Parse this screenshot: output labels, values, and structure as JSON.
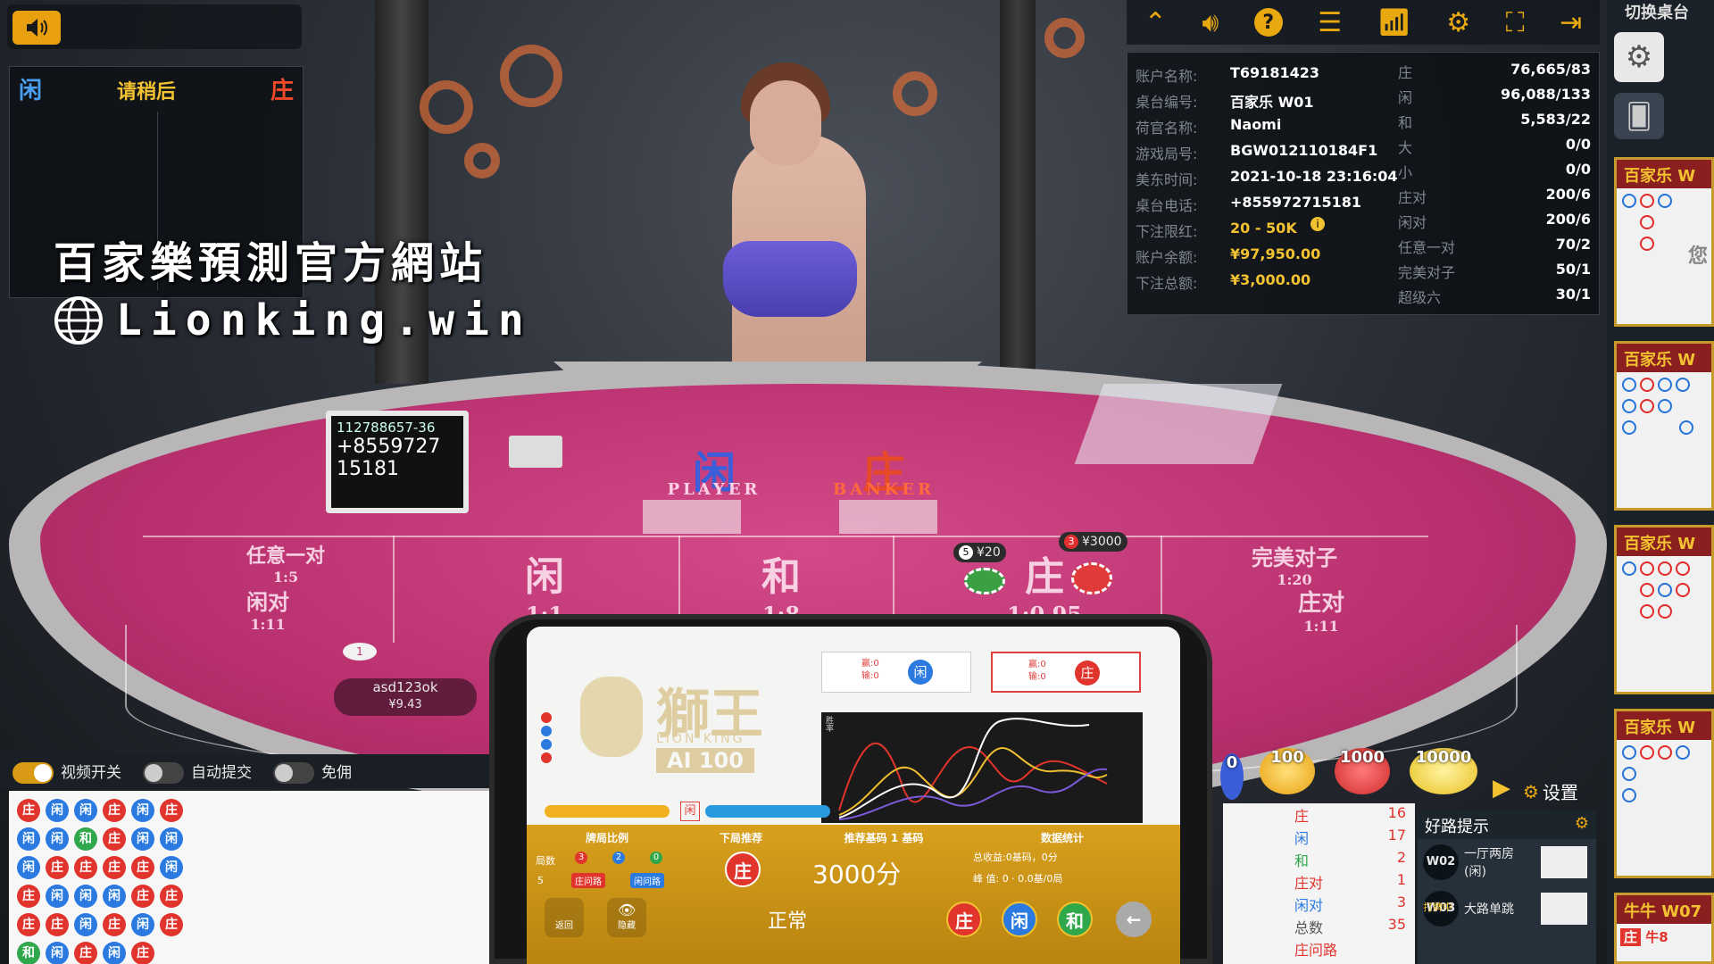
{
  "top_left": {
    "status_player": "闲",
    "status_wait": "请稍后",
    "status_banker": "庄"
  },
  "watermark": {
    "line1": "百家樂預測官方網站",
    "line2": "Lionking.win"
  },
  "info": {
    "rows": [
      {
        "label": "账户名称:",
        "value": "T69181423"
      },
      {
        "label": "桌台编号:",
        "value": "百家乐 W01"
      },
      {
        "label": "荷官名称:",
        "value": "Naomi"
      },
      {
        "label": "游戏局号:",
        "value": "BGW012110184F1"
      },
      {
        "label": "美东时间:",
        "value": "2021-10-18 23:16:04"
      },
      {
        "label": "桌台电话:",
        "value": "+855972715181"
      },
      {
        "label": "下注限红:",
        "value": "20 - 50K"
      },
      {
        "label": "账户余额:",
        "value": "¥97,950.00"
      },
      {
        "label": "下注总额:",
        "value": "¥3,000.00"
      }
    ],
    "stats": [
      {
        "label": "庄",
        "value": "76,665/83"
      },
      {
        "label": "闲",
        "value": "96,088/133"
      },
      {
        "label": "和",
        "value": "5,583/22"
      },
      {
        "label": "大",
        "value": "0/0"
      },
      {
        "label": "小",
        "value": "0/0"
      },
      {
        "label": "庄对",
        "value": "200/6"
      },
      {
        "label": "闲对",
        "value": "200/6"
      },
      {
        "label": "任意一对",
        "value": "70/2"
      },
      {
        "label": "完美对子",
        "value": "50/1"
      },
      {
        "label": "超级六",
        "value": "30/1"
      }
    ]
  },
  "table": {
    "player_big": "闲",
    "player_en": "PLAYER",
    "banker_big": "庄",
    "banker_en": "BANKER",
    "card_shoe_sign": [
      "112788657-36",
      "+8559727",
      "15181"
    ],
    "zones": [
      {
        "text": "任意一对",
        "odds": "1:5"
      },
      {
        "text": "闲对",
        "odds": "1:11"
      },
      {
        "text": "闲",
        "odds": "1:1"
      },
      {
        "text": "和",
        "odds": "1:8"
      },
      {
        "text": "庄",
        "odds": "1:0.95"
      },
      {
        "text": "完美对子",
        "odds": "1:20"
      },
      {
        "text": "庄对",
        "odds": "1:11"
      }
    ],
    "bet_tags": [
      {
        "count": "5",
        "amount": "¥20"
      },
      {
        "count": "3",
        "amount": "¥3000"
      }
    ],
    "seat_user": "asd123ok",
    "seat_amount": "¥9.43",
    "seat_no": "1"
  },
  "right_col": {
    "switch_label": "切换桌台",
    "cards": [
      "百家乐 W",
      "百家乐 W",
      "百家乐 W",
      "百家乐 W",
      "牛牛 W07"
    ],
    "card_badge": "您",
    "niu_row": [
      "庄",
      "牛8"
    ]
  },
  "bottom_bar": {
    "video": "视频开关",
    "auto": "自动提交",
    "free": "免佣"
  },
  "chips": [
    "100",
    "1000",
    "10000"
  ],
  "chip_partial": "0",
  "settings_label": "设置",
  "stats_panel": [
    {
      "label": "庄",
      "value": "16"
    },
    {
      "label": "闲",
      "value": "17"
    },
    {
      "label": "和",
      "value": "2"
    },
    {
      "label": "庄对",
      "value": "1"
    },
    {
      "label": "闲对",
      "value": "3"
    },
    {
      "label": "总数",
      "value": "35"
    },
    {
      "label": "庄问路",
      "value": ""
    }
  ],
  "hint_panel": {
    "title": "好路提示",
    "items": [
      {
        "badge": "W02",
        "text": "一厅两房(闲)"
      },
      {
        "badge": "W03",
        "text": "大路单跳",
        "tag": "打牌中"
      }
    ]
  },
  "phone": {
    "logo_main": "獅王",
    "logo_en": "LION KING",
    "logo_ver": "AI 100",
    "tab_player": "闲",
    "tab_banker": "庄",
    "tab_meta": [
      "赢:0",
      "输:0"
    ],
    "side_tag": "闲",
    "sections": [
      "牌局比例",
      "下局推荐",
      "推荐基码 1 基码",
      "数据统计"
    ],
    "ratio_label": "局数",
    "ratio_values": [
      "3",
      "2",
      "0"
    ],
    "round_no": "5",
    "road_tags": [
      "庄问路",
      "闲问路"
    ],
    "recommend": "庄",
    "points": "3000分",
    "total": "总收益:0基码，0分",
    "peak": "峰   值: 0 · 0.0基/0局",
    "status": "正常",
    "btn_labels": [
      "庄",
      "闲",
      "和"
    ],
    "icon_labels": [
      "返回",
      "隐藏"
    ],
    "chart_axis": "胜率"
  }
}
